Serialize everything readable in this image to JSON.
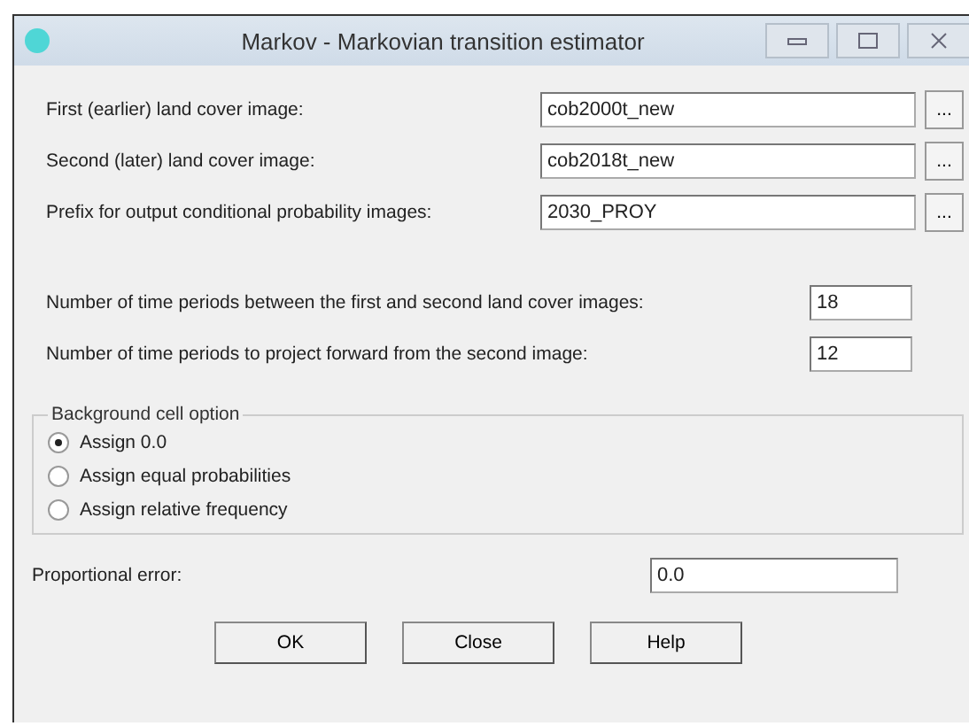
{
  "window": {
    "title": "Markov - Markovian transition estimator"
  },
  "file_fields": [
    {
      "label": "First (earlier) land cover image:",
      "value": "cob2000t_new",
      "button": "..."
    },
    {
      "label": "Second (later) land cover image:",
      "value": "cob2018t_new",
      "button": "..."
    },
    {
      "label": "Prefix for output conditional probability images:",
      "value": "2030_PROY",
      "button": "..."
    }
  ],
  "period_fields": [
    {
      "label": "Number of time periods between the first and second land cover images:",
      "value": "18"
    },
    {
      "label": "Number of time periods to project forward from the second image:",
      "value": "12"
    }
  ],
  "background_group": {
    "title": "Background cell option",
    "options": [
      {
        "label": "Assign 0.0",
        "selected": true
      },
      {
        "label": "Assign equal probabilities",
        "selected": false
      },
      {
        "label": "Assign relative frequency",
        "selected": false
      }
    ]
  },
  "proportional_error": {
    "label": "Proportional error:",
    "value": "0.0"
  },
  "buttons": [
    "OK",
    "Close",
    "Help"
  ]
}
